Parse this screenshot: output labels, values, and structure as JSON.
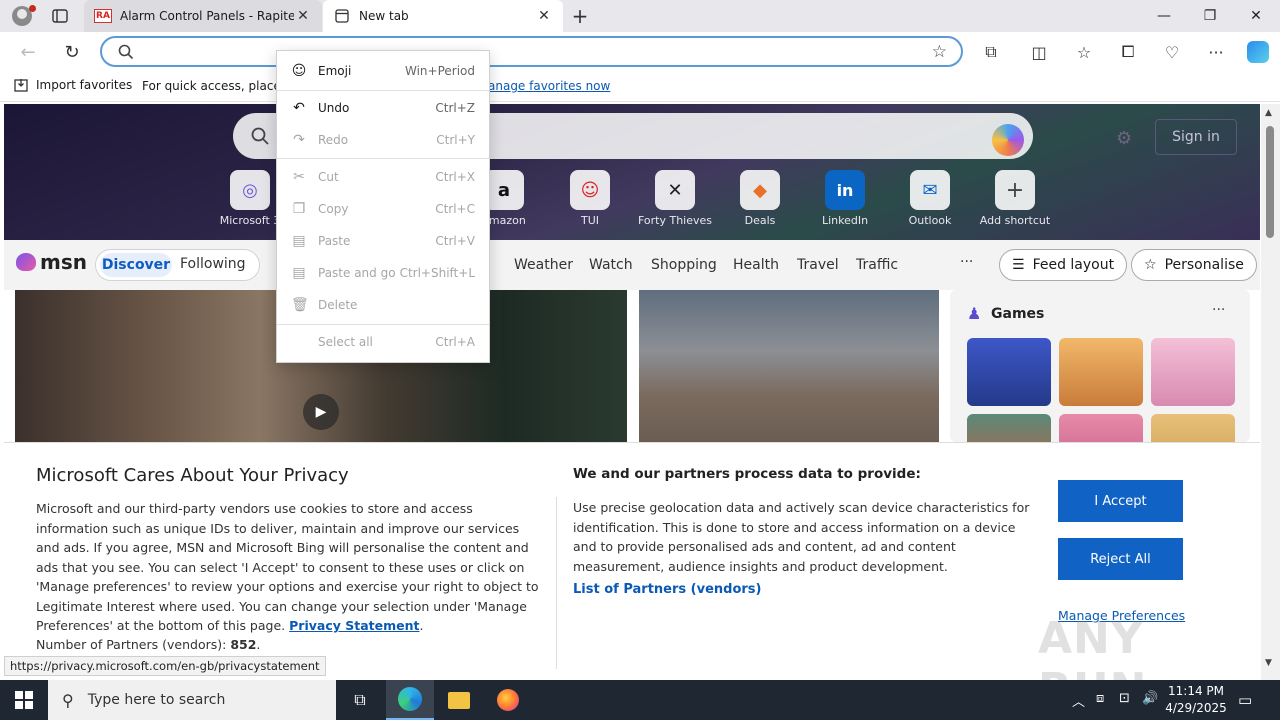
{
  "browser": {
    "tabs": [
      {
        "label": "Alarm Control Panels - Rapitec",
        "favicon": "RA"
      },
      {
        "label": "New tab"
      }
    ],
    "address": {
      "value": "",
      "placeholder": ""
    },
    "favorites_bar": {
      "import_label": "Import favorites",
      "hint": "For quick access, place yo",
      "manage_link": "anage favorites now"
    }
  },
  "context_menu": {
    "items": [
      {
        "icon": "emoji-icon",
        "label": "Emoji",
        "shortcut": "Win+Period",
        "enabled": true
      },
      {
        "icon": "undo-icon",
        "label": "Undo",
        "shortcut": "Ctrl+Z",
        "enabled": true
      },
      {
        "icon": "redo-icon",
        "label": "Redo",
        "shortcut": "Ctrl+Y",
        "enabled": false
      },
      {
        "icon": "cut-icon",
        "label": "Cut",
        "shortcut": "Ctrl+X",
        "enabled": false
      },
      {
        "icon": "copy-icon",
        "label": "Copy",
        "shortcut": "Ctrl+C",
        "enabled": false
      },
      {
        "icon": "paste-icon",
        "label": "Paste",
        "shortcut": "Ctrl+V",
        "enabled": false
      },
      {
        "icon": "paste-go-icon",
        "label": "Paste and go",
        "shortcut": "Ctrl+Shift+L",
        "enabled": false
      },
      {
        "icon": "delete-icon",
        "label": "Delete",
        "shortcut": "",
        "enabled": false
      },
      {
        "icon": "",
        "label": "Select all",
        "shortcut": "Ctrl+A",
        "enabled": false
      }
    ]
  },
  "msn": {
    "sign_in": "Sign in",
    "shortcuts": [
      {
        "label": "Microsoft 3",
        "icon": "office-icon"
      },
      {
        "label": "amazon",
        "icon": "amazon-icon"
      },
      {
        "label": "TUI",
        "icon": "tui-icon"
      },
      {
        "label": "Forty Thieves",
        "icon": "cards-icon"
      },
      {
        "label": "Deals",
        "icon": "deals-icon"
      },
      {
        "label": "LinkedIn",
        "icon": "linkedin-icon"
      },
      {
        "label": "Outlook",
        "icon": "outlook-icon"
      },
      {
        "label": "Add shortcut",
        "icon": "plus-icon"
      }
    ],
    "logo": "msn",
    "pills": {
      "discover": "Discover",
      "following": "Following"
    },
    "categories": [
      "Weather",
      "Watch",
      "Shopping",
      "Health",
      "Travel",
      "Traffic"
    ],
    "more": "···",
    "feed_layout": "Feed layout",
    "personalise": "Personalise",
    "games_title": "Games",
    "games_more": "···"
  },
  "privacy": {
    "title": "Microsoft Cares About Your Privacy",
    "body": "Microsoft and our third-party vendors use cookies to store and access information such as unique IDs to deliver, maintain and improve our services and ads. If you agree, MSN and Microsoft Bing will personalise the content and ads that you see. You can select 'I Accept' to consent to these uses or click on 'Manage preferences' to review your options and exercise your right to object to Legitimate Interest where used.  You can change your selection under 'Manage Preferences' at the bottom of this page.",
    "privacy_link": "Privacy Statement",
    "partners_label": "Number of Partners (vendors):",
    "partners_count": "852",
    "right_title": "We and our partners process data to provide:",
    "right_body": "Use precise geolocation data and actively scan device characteristics for identification. This is done to store and access information on a device and to provide personalised ads and content, ad and content measurement, audience insights and product development.",
    "list_link": "List of Partners (vendors)",
    "accept": "I Accept",
    "reject": "Reject All",
    "manage": "Manage Preferences",
    "watermark": "ANY RUN"
  },
  "status_url": "https://privacy.microsoft.com/en-gb/privacystatement",
  "taskbar": {
    "search_placeholder": "Type here to search",
    "time": "11:14 PM",
    "date": "4/29/2025"
  },
  "colors": {
    "accent": "#1063c4",
    "link": "#0a5ab4",
    "address_border": "#5b9bd5"
  }
}
